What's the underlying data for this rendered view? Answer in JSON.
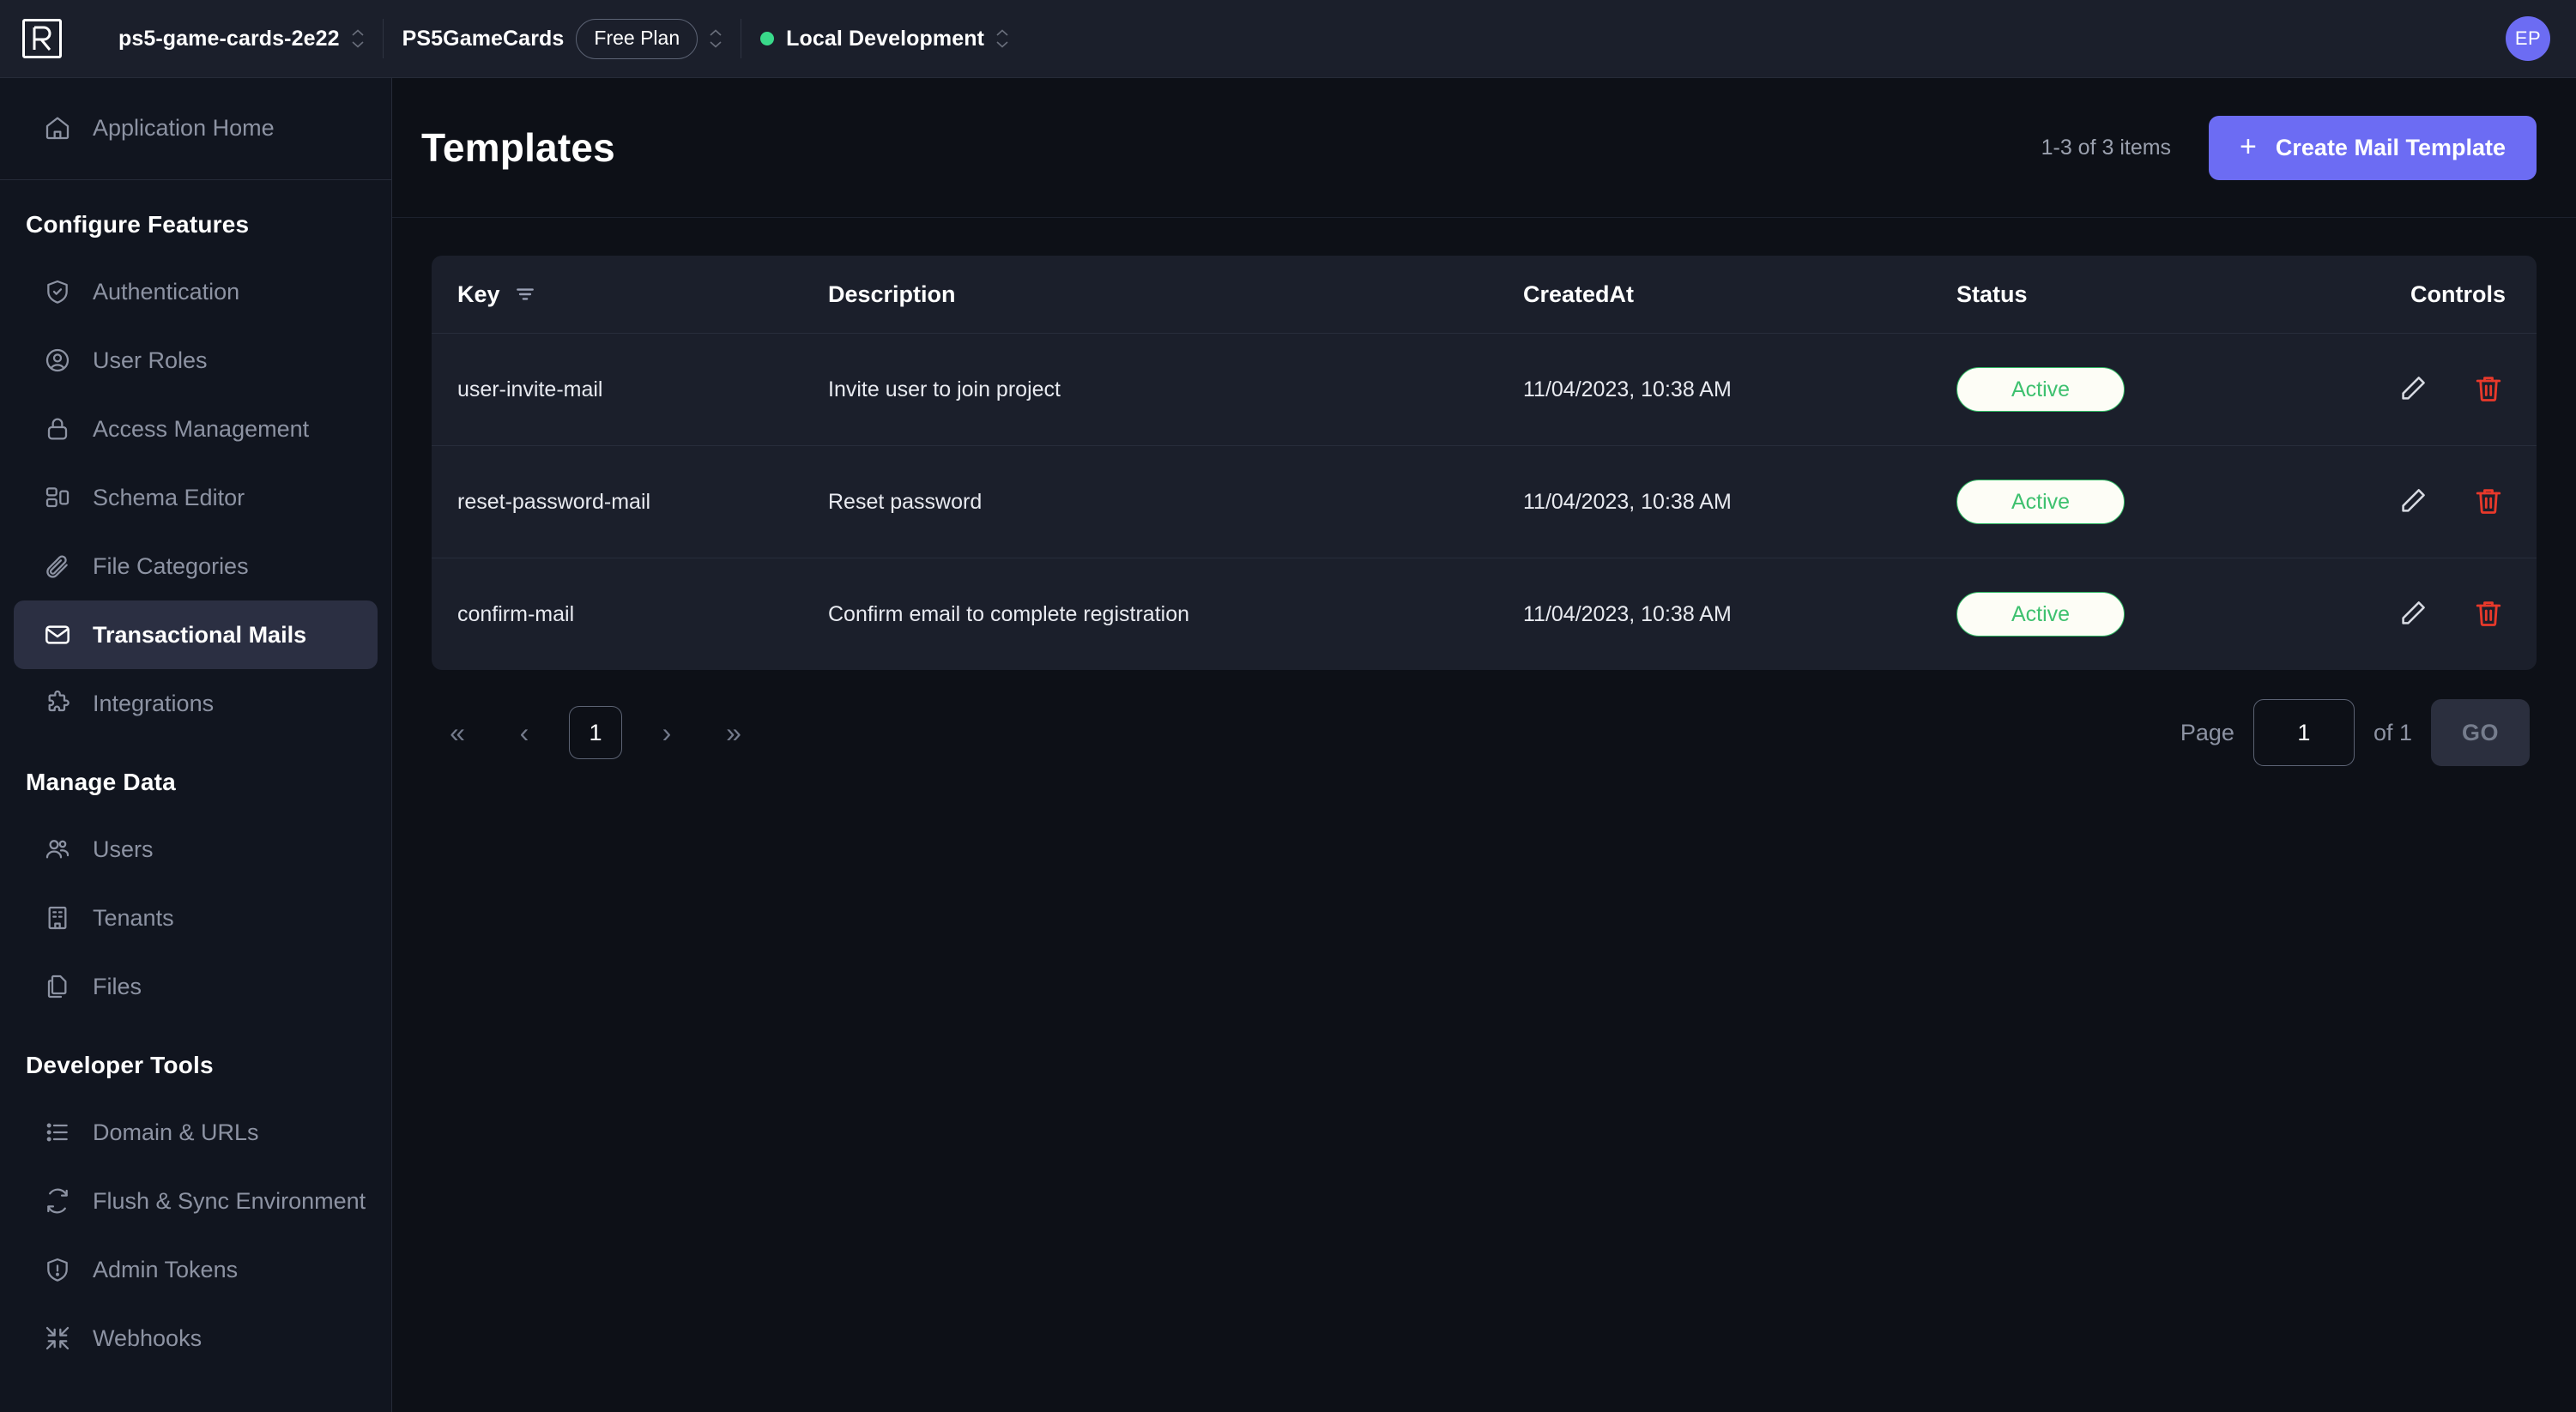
{
  "topbar": {
    "logo_icon": "rowy-logo-icon",
    "project_name": "ps5-game-cards-2e22",
    "workspace_name": "PS5GameCards",
    "plan_label": "Free Plan",
    "environment_name": "Local Development",
    "environment_status_color": "#39d98a",
    "avatar_initials": "EP",
    "avatar_color": "#6c6cf3"
  },
  "sidebar": {
    "home": {
      "label": "Application Home",
      "icon": "home-icon"
    },
    "sections": [
      {
        "title": "Configure Features",
        "items": [
          {
            "label": "Authentication",
            "icon": "shield-check-icon",
            "active": false
          },
          {
            "label": "User Roles",
            "icon": "user-circle-icon",
            "active": false
          },
          {
            "label": "Access Management",
            "icon": "lock-icon",
            "active": false
          },
          {
            "label": "Schema Editor",
            "icon": "schema-icon",
            "active": false
          },
          {
            "label": "File Categories",
            "icon": "paperclip-icon",
            "active": false
          },
          {
            "label": "Transactional Mails",
            "icon": "mail-icon",
            "active": true
          },
          {
            "label": "Integrations",
            "icon": "puzzle-icon",
            "active": false
          }
        ]
      },
      {
        "title": "Manage Data",
        "items": [
          {
            "label": "Users",
            "icon": "users-icon",
            "active": false
          },
          {
            "label": "Tenants",
            "icon": "building-icon",
            "active": false
          },
          {
            "label": "Files",
            "icon": "files-icon",
            "active": false
          }
        ]
      },
      {
        "title": "Developer Tools",
        "items": [
          {
            "label": "Domain & URLs",
            "icon": "list-icon",
            "active": false
          },
          {
            "label": "Flush & Sync Environment",
            "icon": "refresh-icon",
            "active": false
          },
          {
            "label": "Admin Tokens",
            "icon": "shield-alert-icon",
            "active": false
          },
          {
            "label": "Webhooks",
            "icon": "collapse-icon",
            "active": false
          }
        ]
      }
    ]
  },
  "main": {
    "title": "Templates",
    "item_count": "1-3 of 3 items",
    "create_button": {
      "label": "Create Mail Template",
      "plus": "+",
      "color": "#6c6cf3"
    }
  },
  "table": {
    "columns": [
      "Key",
      "Description",
      "CreatedAt",
      "Status",
      "Controls"
    ],
    "filter_icon": "filter-icon",
    "rows": [
      {
        "key": "user-invite-mail",
        "description": "Invite user to join project",
        "created_at": "11/04/2023, 10:38 AM",
        "status": "Active",
        "edit_icon": "pencil-icon",
        "delete_icon": "trash-icon"
      },
      {
        "key": "reset-password-mail",
        "description": "Reset password",
        "created_at": "11/04/2023, 10:38 AM",
        "status": "Active",
        "edit_icon": "pencil-icon",
        "delete_icon": "trash-icon"
      },
      {
        "key": "confirm-mail",
        "description": "Confirm email to complete registration",
        "created_at": "11/04/2023, 10:38 AM",
        "status": "Active",
        "edit_icon": "pencil-icon",
        "delete_icon": "trash-icon"
      }
    ],
    "status_text_color": "#3ec16f",
    "delete_icon_color": "#e8392b"
  },
  "pagination": {
    "first_label": "«",
    "prev_label": "‹",
    "current_page": "1",
    "next_label": "›",
    "last_label": "»",
    "page_label": "Page",
    "page_input_value": "1",
    "of_label": "of 1",
    "go_label": "GO"
  }
}
